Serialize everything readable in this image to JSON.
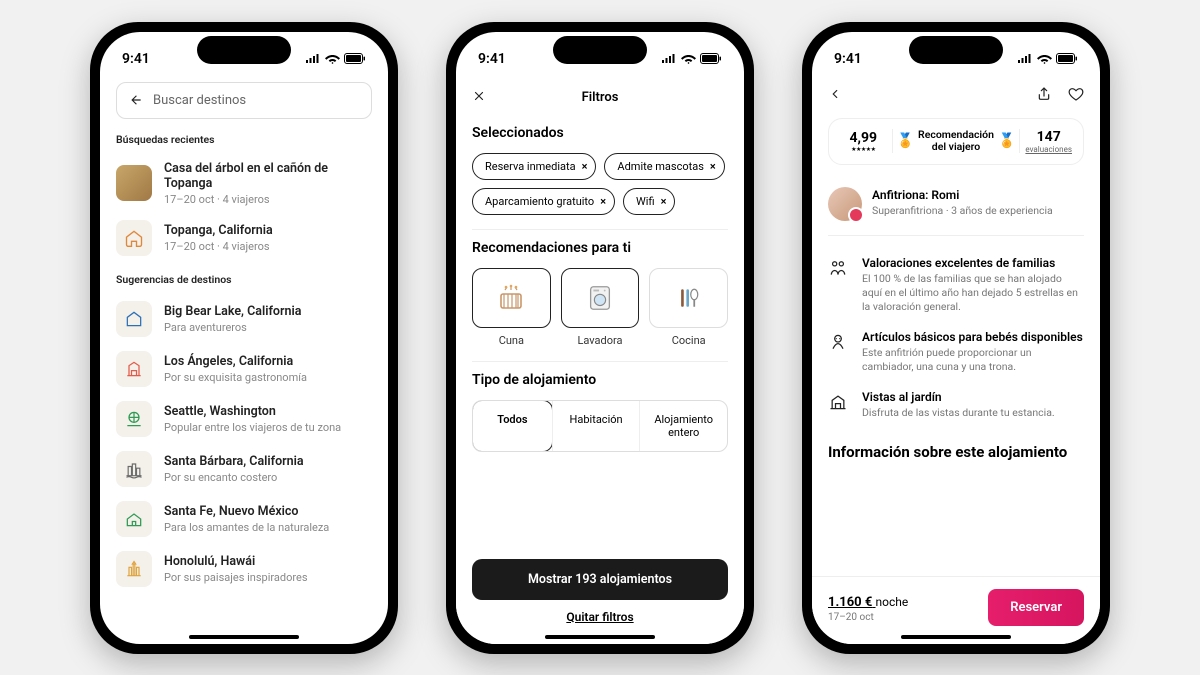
{
  "status": {
    "time": "9:41"
  },
  "phone1": {
    "search_placeholder": "Buscar destinos",
    "recent_label": "Búsquedas recientes",
    "recent": [
      {
        "title": "Casa del árbol en el cañón de Topanga",
        "sub": "17–20 oct · 4 viajeros",
        "icon": "treehouse"
      },
      {
        "title": "Topanga, California",
        "sub": "17–20 oct · 4 viajeros",
        "icon": "house-orange"
      }
    ],
    "suggest_label": "Sugerencias de destinos",
    "suggestions": [
      {
        "title": "Big Bear Lake, California",
        "sub": "Para aventureros",
        "color": "#2b6fb8"
      },
      {
        "title": "Los Ángeles, California",
        "sub": "Por su exquisita gastronomía",
        "color": "#e25b4a"
      },
      {
        "title": "Seattle, Washington",
        "sub": "Popular entre los viajeros de tu zona",
        "color": "#2e9b55"
      },
      {
        "title": "Santa Bárbara, California",
        "sub": "Por su encanto costero",
        "color": "#6b6b6b"
      },
      {
        "title": "Santa Fe, Nuevo México",
        "sub": "Para los amantes de la naturaleza",
        "color": "#2e9b55"
      },
      {
        "title": "Honolulú, Hawái",
        "sub": "Por sus paisajes inspiradores",
        "color": "#e0a23a"
      }
    ]
  },
  "phone2": {
    "header": "Filtros",
    "selected_label": "Seleccionados",
    "chips": [
      "Reserva inmediata",
      "Admite mascotas",
      "Aparcamiento gratuito",
      "Wifi"
    ],
    "rec_label": "Recomendaciones para ti",
    "recs": [
      {
        "label": "Cuna",
        "selected": true
      },
      {
        "label": "Lavadora",
        "selected": true
      },
      {
        "label": "Cocina",
        "selected": false
      }
    ],
    "type_label": "Tipo de alojamiento",
    "types": [
      "Todos",
      "Habitación",
      "Alojamiento entero"
    ],
    "show_btn": "Mostrar 193 alojamientos",
    "clear": "Quitar filtros"
  },
  "phone3": {
    "rating": "4,99",
    "award": "Recomendación del viajero",
    "reviews_num": "147",
    "reviews_label": "evaluaciones",
    "host_label": "Anfitriona: Romi",
    "host_sub": "Superanfitriona · 3 años de experiencia",
    "features": [
      {
        "title": "Valoraciones excelentes de familias",
        "sub": "El 100 % de las familias que se han alojado aquí en el último año han dejado 5 estrellas en la valoración general."
      },
      {
        "title": "Artículos básicos para bebés disponibles",
        "sub": "Este anfitrión puede proporcionar un cambiador, una cuna y una trona."
      },
      {
        "title": "Vistas al jardín",
        "sub": "Disfruta de las vistas durante tu estancia."
      }
    ],
    "info_heading": "Información sobre este alojamiento",
    "price": "1.160 €",
    "price_unit": "noche",
    "dates": "17–20 oct",
    "reserve": "Reservar"
  }
}
